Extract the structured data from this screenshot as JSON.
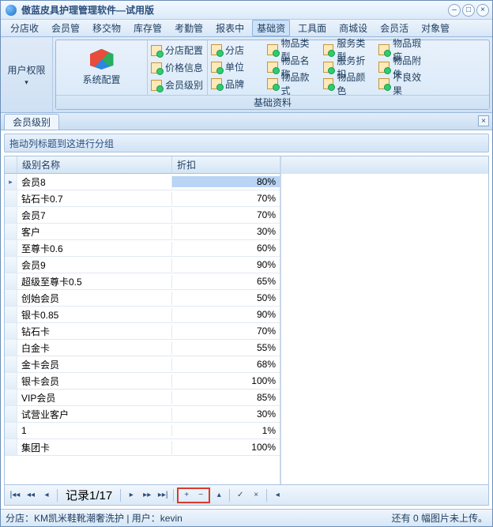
{
  "window_title": "傲蓝皮具护理管理软件—试用版",
  "menus": [
    "分店收",
    "会员管",
    "移交物",
    "库存管",
    "考勤管",
    "报表中",
    "基础资",
    "工具面",
    "商城设",
    "会员活",
    "对象管"
  ],
  "active_menu_index": 6,
  "ribbon_left_label": "用户权限",
  "system_config_label": "系统配置",
  "col2_items": [
    "分店配置",
    "价格信息",
    "会员级别"
  ],
  "grid_items": [
    "分店",
    "物品类型",
    "服务类型",
    "物品瑕疵",
    "",
    "单位",
    "物品名称",
    "服务折扣",
    "物品附件",
    "",
    "品牌",
    "物品款式",
    "物品颜色",
    "不良效果",
    ""
  ],
  "ribbon_caption": "基础资料",
  "tab_label": "会员级别",
  "group_hint": "拖动列标题到这进行分组",
  "col_name": "级别名称",
  "col_discount": "折扣",
  "rows": [
    {
      "name": "会员8",
      "disc": "80%",
      "sel": true,
      "cur": true
    },
    {
      "name": "钻石卡0.7",
      "disc": "70%"
    },
    {
      "name": "会员7",
      "disc": "70%"
    },
    {
      "name": "客户",
      "disc": "30%"
    },
    {
      "name": "至尊卡0.6",
      "disc": "60%"
    },
    {
      "name": "会员9",
      "disc": "90%"
    },
    {
      "name": "超级至尊卡0.5",
      "disc": "65%"
    },
    {
      "name": "创始会员",
      "disc": "50%"
    },
    {
      "name": "银卡0.85",
      "disc": "90%"
    },
    {
      "name": "钻石卡",
      "disc": "70%"
    },
    {
      "name": "白金卡",
      "disc": "55%"
    },
    {
      "name": "金卡会员",
      "disc": "68%"
    },
    {
      "name": "银卡会员",
      "disc": "100%"
    },
    {
      "name": "VIP会员",
      "disc": "85%"
    },
    {
      "name": "试营业客户",
      "disc": "30%"
    },
    {
      "name": "1",
      "disc": "1%"
    },
    {
      "name": "集团卡",
      "disc": "100%"
    }
  ],
  "record_label": "记录1/17",
  "status_left": "分店：KM凯米鞋靴潮奢洗护 | 用户：kevin",
  "status_right": "还有 0 幅图片未上传。"
}
